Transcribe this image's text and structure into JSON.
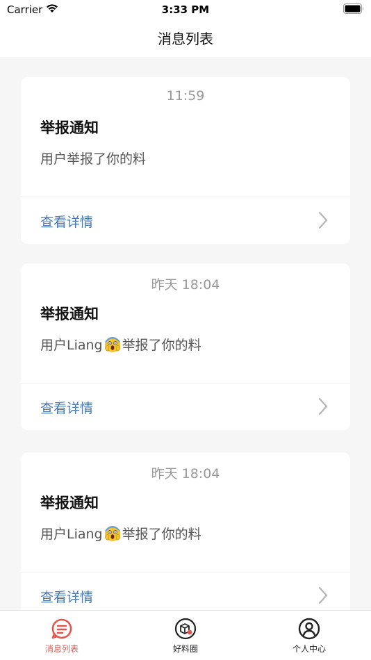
{
  "status_bar": {
    "carrier": "Carrier",
    "time": "3:33 PM",
    "icons": [
      "wifi-icon",
      "battery-icon"
    ]
  },
  "nav": {
    "title": "消息列表"
  },
  "messages": [
    {
      "time": "11:59",
      "title": "举报通知",
      "body_prefix": "用户举报了你的料",
      "emoji": "",
      "body_suffix": "",
      "action": "查看详情"
    },
    {
      "time": "昨天 18:04",
      "title": "举报通知",
      "body_prefix": "用户Liang",
      "emoji": "screaming-face-emoji",
      "body_suffix": "举报了你的料",
      "action": "查看详情"
    },
    {
      "time": "昨天 18:04",
      "title": "举报通知",
      "body_prefix": "用户Liang",
      "emoji": "screaming-face-emoji",
      "body_suffix": "举报了你的料",
      "action": "查看详情"
    }
  ],
  "tabs": [
    {
      "label": "消息列表",
      "icon": "message-list-icon",
      "active": true
    },
    {
      "label": "好料圈",
      "icon": "box-circle-icon",
      "active": false
    },
    {
      "label": "个人中心",
      "icon": "user-circle-icon",
      "active": false
    }
  ],
  "colors": {
    "active_tab": "#e0584f",
    "inactive_tab": "#222222",
    "link": "#4a78b0",
    "background": "#f6f6f6"
  }
}
